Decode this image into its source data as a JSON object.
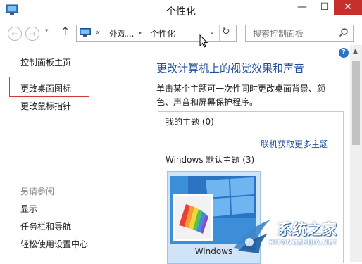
{
  "window": {
    "title": "个性化",
    "controls": {
      "minimize": "—",
      "maximize": "☐",
      "close": "✕"
    }
  },
  "nav": {
    "back_icon": "←",
    "forward_icon": "→",
    "dropdown_icon": "▾",
    "up_icon": "↑",
    "address": {
      "prefix": "«",
      "part1": "外观...",
      "separator": "▸",
      "part2": "个性化",
      "dropdown_icon": "⌄",
      "refresh_icon": "↻"
    },
    "search": {
      "placeholder": "搜索控制面板"
    }
  },
  "sidebar": {
    "home": "控制面板主页",
    "items": [
      {
        "label": "更改桌面图标"
      },
      {
        "label": "更改鼠标指针"
      }
    ],
    "see_also": {
      "header": "另请参阅",
      "links": [
        {
          "label": "显示"
        },
        {
          "label": "任务栏和导航"
        },
        {
          "label": "轻松使用设置中心"
        }
      ]
    }
  },
  "main": {
    "help_icon": "?",
    "title": "更改计算机上的视觉效果和声音",
    "description": "单击某个主题可一次性同时更改桌面背景、颜色、声音和屏幕保护程序。",
    "my_themes": "我的主题 (0)",
    "online_link": "联机获取更多主题",
    "default_themes": "Windows 默认主题 (3)",
    "theme": {
      "name": "Windows"
    }
  },
  "watermark": {
    "text": "系统之家",
    "url": "XITONGZHIJIA.NET"
  },
  "colors": {
    "accent_link": "#1e4f99",
    "close_button": "#c7302a",
    "highlight_box": "#d23a3a",
    "theme_tile_bg": "#cfe4f7"
  }
}
